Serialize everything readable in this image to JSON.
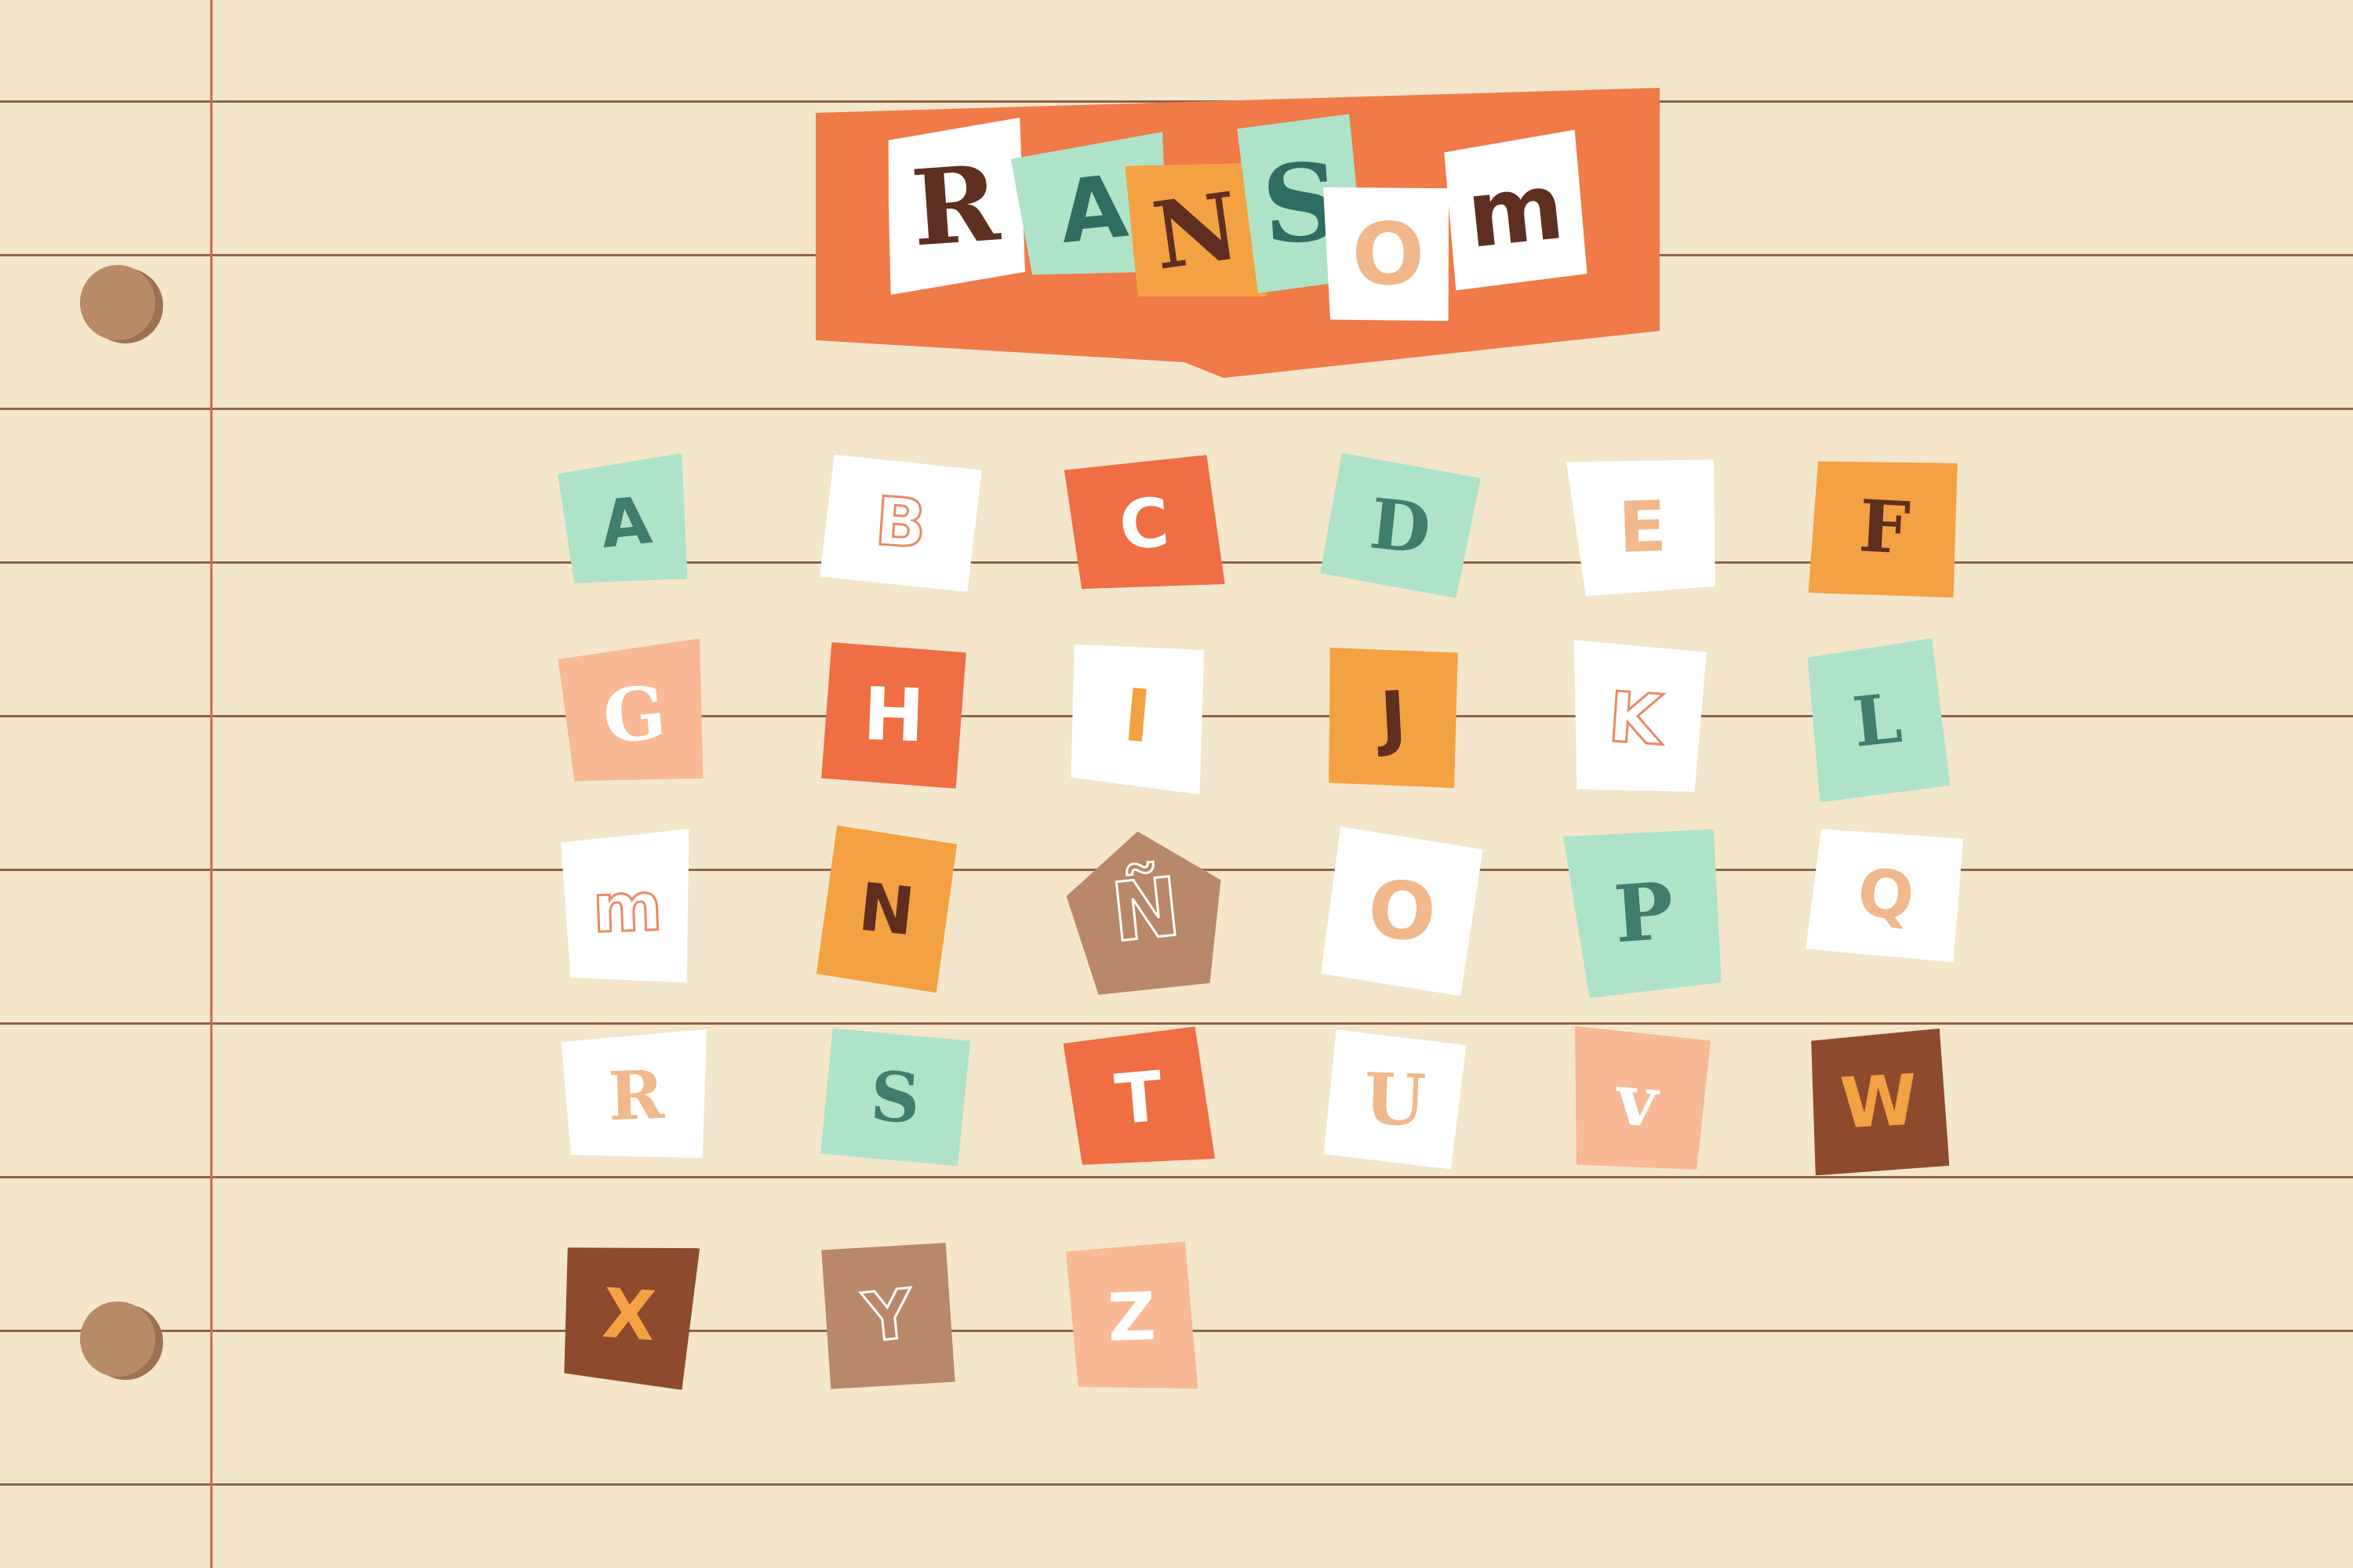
{
  "title": {
    "letters": [
      {
        "char": "R",
        "paper": "#ffffff",
        "ink": "#5e2f1f",
        "font": "serif"
      },
      {
        "char": "A",
        "paper": "#aee3c8",
        "ink": "#2f6d62",
        "font": "sans"
      },
      {
        "char": "N",
        "paper": "#f4a143",
        "ink": "#5e2f1f",
        "font": "serif"
      },
      {
        "char": "S",
        "paper": "#aee3c8",
        "ink": "#2f6d62",
        "font": "serif"
      },
      {
        "char": "O",
        "paper": "#ffffff",
        "ink": "#f1b88c",
        "font": "sans"
      },
      {
        "char": "m",
        "paper": "#ffffff",
        "ink": "#5e2f1f",
        "font": "sans"
      }
    ],
    "banner_color": "#f07a48"
  },
  "alphabet": [
    {
      "char": "A",
      "paper": "#aee3c8",
      "ink": "#3f7d6d",
      "font": "sans",
      "style": "pattern"
    },
    {
      "char": "B",
      "paper": "#ffffff",
      "ink": "#e98a62",
      "font": "sans",
      "style": "outline"
    },
    {
      "char": "C",
      "paper": "#ef6e44",
      "ink": "#ffffff",
      "font": "sans",
      "style": "plain"
    },
    {
      "char": "D",
      "paper": "#aee3c8",
      "ink": "#3f7d6d",
      "font": "serif",
      "style": "pattern"
    },
    {
      "char": "E",
      "paper": "#ffffff",
      "ink": "#f1b88c",
      "font": "sans",
      "style": "plain"
    },
    {
      "char": "F",
      "paper": "#f4a143",
      "ink": "#5e2f1f",
      "font": "serif",
      "style": "plain"
    },
    {
      "char": "G",
      "paper": "#f8b994",
      "ink": "#ffffff",
      "font": "serif",
      "style": "plain"
    },
    {
      "char": "H",
      "paper": "#ef6e44",
      "ink": "#ffffff",
      "font": "sans",
      "style": "brick"
    },
    {
      "char": "I",
      "paper": "#ffffff",
      "ink": "#f4a143",
      "font": "sans",
      "style": "plain"
    },
    {
      "char": "J",
      "paper": "#f4a143",
      "ink": "#5e2f1f",
      "font": "sans",
      "style": "plain"
    },
    {
      "char": "K",
      "paper": "#ffffff",
      "ink": "#e98a62",
      "font": "sans",
      "style": "outline"
    },
    {
      "char": "L",
      "paper": "#aee3c8",
      "ink": "#3f7d6d",
      "font": "serif",
      "style": "pattern"
    },
    {
      "char": "m",
      "paper": "#ffffff",
      "ink": "#e98a62",
      "font": "sans",
      "style": "outline"
    },
    {
      "char": "N",
      "paper": "#f4a143",
      "ink": "#5e2f1f",
      "font": "sans",
      "style": "plain"
    },
    {
      "char": "Ñ",
      "paper": "#b9876a",
      "ink": "#ffffff",
      "font": "sans",
      "style": "checker-outline"
    },
    {
      "char": "O",
      "paper": "#ffffff",
      "ink": "#f1b88c",
      "font": "sans",
      "style": "plain"
    },
    {
      "char": "P",
      "paper": "#aee3c8",
      "ink": "#3f7d6d",
      "font": "serif",
      "style": "pattern"
    },
    {
      "char": "Q",
      "paper": "#ffffff",
      "ink": "#f1b88c",
      "font": "sans",
      "style": "plain"
    },
    {
      "char": "R",
      "paper": "#ffffff",
      "ink": "#f1b88c",
      "font": "serif",
      "style": "plain"
    },
    {
      "char": "S",
      "paper": "#aee3c8",
      "ink": "#3f7d6d",
      "font": "serif",
      "style": "pattern"
    },
    {
      "char": "T",
      "paper": "#ef6e44",
      "ink": "#ffffff",
      "font": "sans",
      "style": "brick"
    },
    {
      "char": "U",
      "paper": "#ffffff",
      "ink": "#f1b88c",
      "font": "serif",
      "style": "plain"
    },
    {
      "char": "v",
      "paper": "#f8b994",
      "ink": "#ffffff",
      "font": "serif",
      "style": "plain"
    },
    {
      "char": "W",
      "paper": "#8e4a2d",
      "ink": "#f4a143",
      "font": "sans",
      "style": "plain"
    },
    {
      "char": "X",
      "paper": "#8e4a2d",
      "ink": "#f4a143",
      "font": "sans",
      "style": "plain"
    },
    {
      "char": "Y",
      "paper": "#b9876a",
      "ink": "#ffffff",
      "font": "sans",
      "style": "checker-outline"
    },
    {
      "char": "Z",
      "paper": "#f8b994",
      "ink": "#ffffff",
      "font": "sans",
      "style": "plain"
    }
  ],
  "colors": {
    "paper_background": "#f3e6cb",
    "ruled_lines": "#8f6448",
    "margin_line": "#d26a55",
    "punch_holes": "#b98a66"
  }
}
